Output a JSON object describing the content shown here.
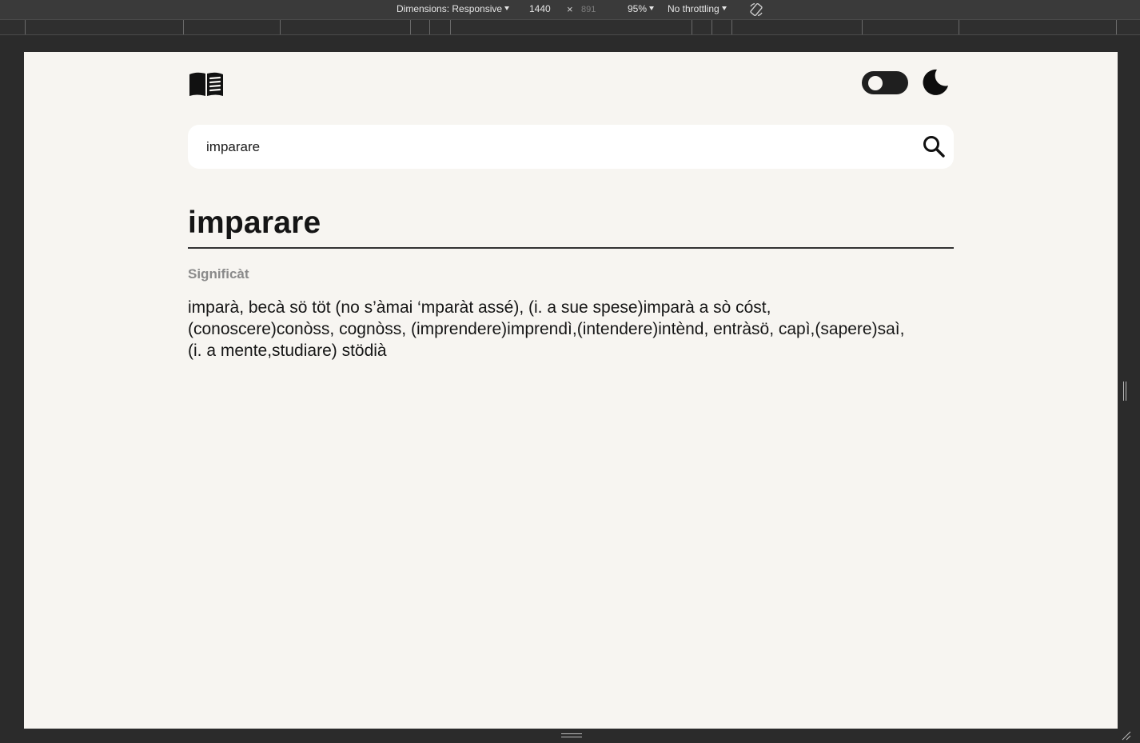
{
  "devtools": {
    "dimensions_label": "Dimensions: Responsive",
    "width": "1440",
    "times": "×",
    "height": "891",
    "zoom": "95%",
    "throttling": "No throttling",
    "rotate_icon": "rotate-device-icon"
  },
  "header": {
    "logo_icon": "open-book-icon",
    "toggle_state": "off",
    "theme_icon": "moon-icon"
  },
  "search": {
    "value": "imparare",
    "icon": "search-icon"
  },
  "entry": {
    "word": "imparare",
    "section_label": "Significàt",
    "meaning_lines": [
      "imparà, becà sö töt (no s’àmai ‘mparàt assé), (i. a sue spese)imparà a sò cóst,",
      "(conoscere)conòss, cognòss, (imprendere)imprendì,(intendere)intènd, entràsö, capì,(sapere)saì,",
      "(i. a mente,studiare) stödià"
    ]
  },
  "colors": {
    "page_background": "#f7f5f1",
    "chrome_background": "#2b2b2b",
    "text": "#161616",
    "muted_label": "#8a8a8a"
  }
}
